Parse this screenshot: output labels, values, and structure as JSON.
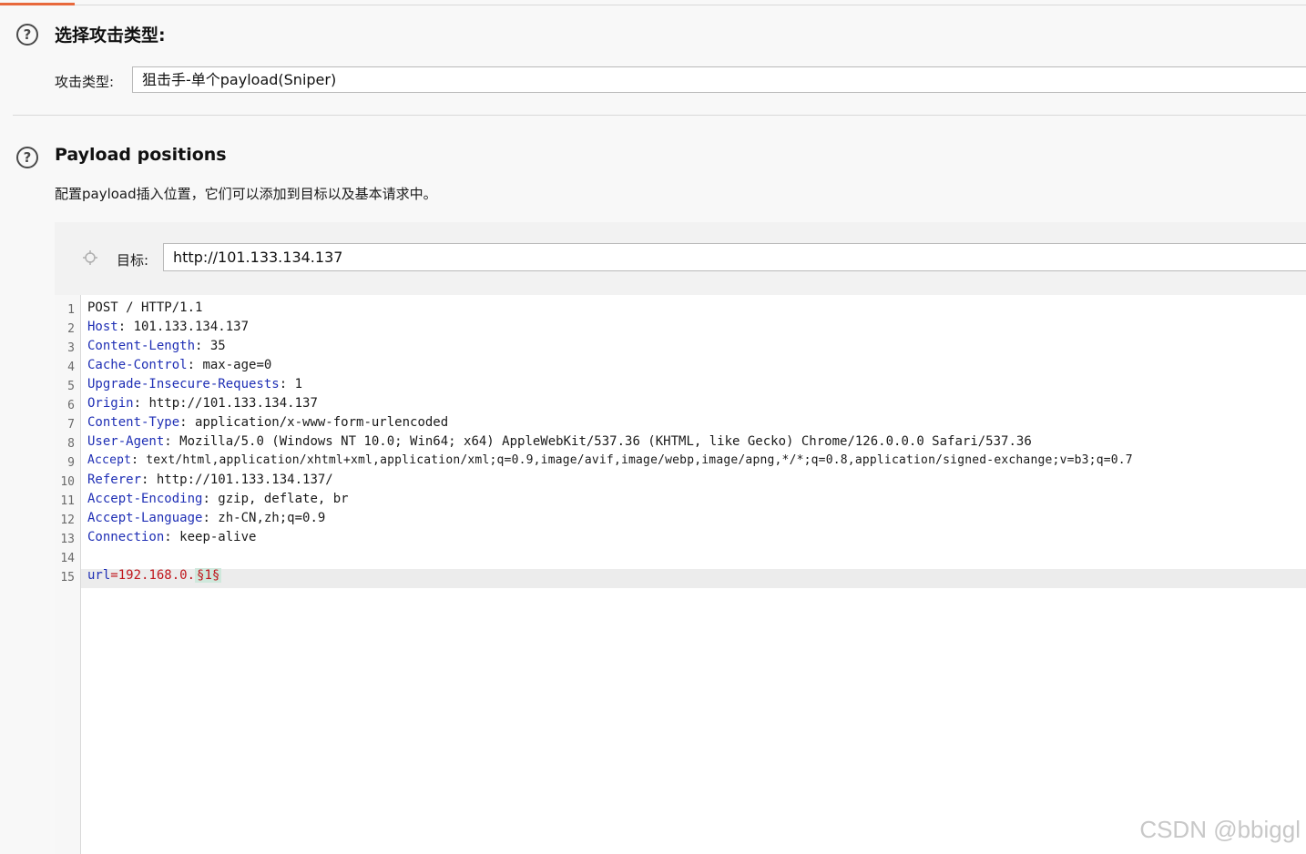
{
  "attack_section": {
    "help_icon": "?",
    "title": "选择攻击类型:",
    "label": "攻击类型:",
    "selected": "狙击手-单个payload(Sniper)"
  },
  "positions_section": {
    "help_icon": "?",
    "title": "Payload positions",
    "description": "配置payload插入位置，它们可以添加到目标以及基本请求中。",
    "target_label": "目标:",
    "target_value": "http://101.133.134.137"
  },
  "request": {
    "request_line": "POST / HTTP/1.1",
    "headers": [
      {
        "name": "Host",
        "value": "101.133.134.137"
      },
      {
        "name": "Content-Length",
        "value": "35"
      },
      {
        "name": "Cache-Control",
        "value": "max-age=0"
      },
      {
        "name": "Upgrade-Insecure-Requests",
        "value": "1"
      },
      {
        "name": "Origin",
        "value": "http://101.133.134.137"
      },
      {
        "name": "Content-Type",
        "value": "application/x-www-form-urlencoded"
      },
      {
        "name": "User-Agent",
        "value": "Mozilla/5.0 (Windows NT 10.0; Win64; x64) AppleWebKit/537.36 (KHTML, like Gecko) Chrome/126.0.0.0 Safari/537.36"
      },
      {
        "name": "Accept",
        "value": "text/html,application/xhtml+xml,application/xml;q=0.9,image/avif,image/webp,image/apng,*/*;q=0.8,application/signed-exchange;v=b3;q=0.7"
      },
      {
        "name": "Referer",
        "value": "http://101.133.134.137/"
      },
      {
        "name": "Accept-Encoding",
        "value": "gzip, deflate, br"
      },
      {
        "name": "Accept-Language",
        "value": "zh-CN,zh;q=0.9"
      },
      {
        "name": "Connection",
        "value": "keep-alive"
      }
    ],
    "body_key": "url",
    "body_eq": "=",
    "body_value": "192.168.0.",
    "payload_marker": "§1§",
    "line_numbers": [
      "1",
      "2",
      "3",
      "4",
      "5",
      "6",
      "7",
      "8",
      "9",
      "10",
      "11",
      "12",
      "13",
      "14",
      "15"
    ]
  },
  "watermark": "CSDN @bbiggl",
  "colors": {
    "accent": "#e8693c",
    "header_name": "#1f2fb5",
    "body_value": "#c0161c",
    "payload_marker_bg": "#cfe8dc"
  }
}
